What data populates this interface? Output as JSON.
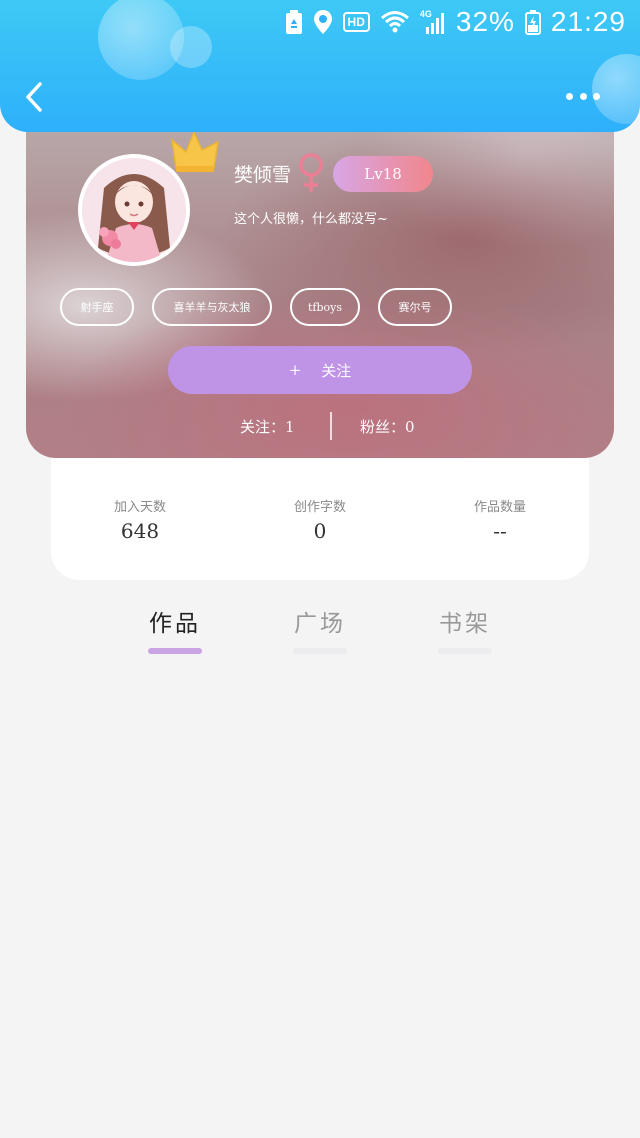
{
  "status_bar": {
    "battery_percent": "32%",
    "time": "21:29",
    "hd_label": "HD",
    "network_label": "4G"
  },
  "header": {
    "back_icon": "chevron-left-icon",
    "more_icon": "more-dots-icon"
  },
  "profile": {
    "username": "樊倾雪",
    "gender_icon": "female-symbol-icon",
    "level": "Lv18",
    "bio": "这个人很懒，什么都没写~",
    "tags": [
      "射手座",
      "喜羊羊与灰太狼",
      "tfboys",
      "赛尔号"
    ],
    "follow_button_plus": "+",
    "follow_button_label": "关注",
    "following_text": "关注：1",
    "fans_text": "粉丝：0"
  },
  "stats": [
    {
      "label": "加入天数",
      "value": "648"
    },
    {
      "label": "创作字数",
      "value": "0"
    },
    {
      "label": "作品数量",
      "value": "--"
    }
  ],
  "tabs": [
    {
      "label": "作品",
      "active": true
    },
    {
      "label": "广场",
      "active": false
    },
    {
      "label": "书架",
      "active": false
    }
  ],
  "colors": {
    "header_blue": "#2eb0fb",
    "follow_purple": "#bf93e6",
    "tab_underline_active": "#c9a3e4",
    "level_gradient_start": "#d8a6e6",
    "level_gradient_end": "#f1868b"
  }
}
